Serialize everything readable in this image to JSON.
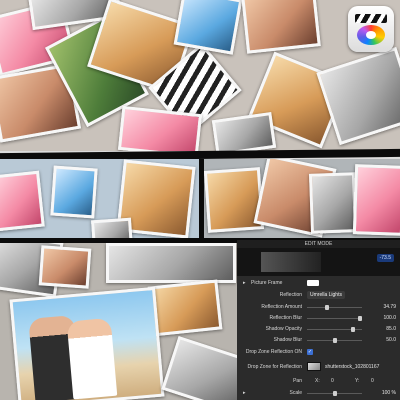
{
  "app": {
    "name": "Final Cut Pro",
    "logo_icon": "final-cut-pro-logo-icon"
  },
  "inspector": {
    "title": "EDIT MODE",
    "zoom_value": "-73.5",
    "picture_frame": {
      "label": "Picture Frame"
    },
    "reflection": {
      "label": "Reflection",
      "value": "Umrella Lights"
    },
    "reflection_amount": {
      "label": "Reflection Amount",
      "value": "34.79",
      "level": 0.35
    },
    "reflection_blur": {
      "label": "Reflection Blur",
      "value": "100.0",
      "level": 1.0
    },
    "shadow_opacity": {
      "label": "Shadow Opacity",
      "value": "85.0",
      "level": 0.85
    },
    "shadow_blur": {
      "label": "Shadow Blur",
      "value": "50.0",
      "level": 0.5
    },
    "drop_zone_reflection_on": {
      "label": "Drop Zone Reflection ON",
      "checked": true
    },
    "drop_zone_for_reflection": {
      "label": "Drop Zone for Reflection",
      "filename": "shutterstock_102801167"
    },
    "pan": {
      "label": "Pan",
      "x_label": "X:",
      "x_value": "0",
      "y_label": "Y:",
      "y_value": "0"
    },
    "scale": {
      "label": "Scale",
      "value": "100 %"
    }
  },
  "colors": {
    "separator": "#0b0b0b",
    "inspector_bg": "#2b2b2b",
    "checkbox_blue": "#3b6fd4"
  }
}
